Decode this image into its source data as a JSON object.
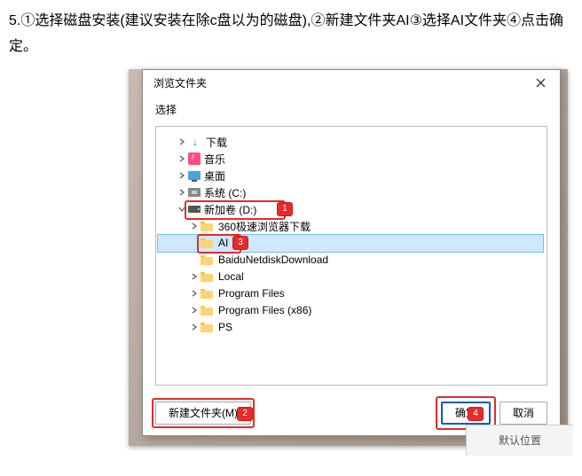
{
  "instruction": "5.①选择磁盘安装(建议安装在除c盘以为的磁盘),②新建文件夹AI③选择AI文件夹④点击确定。",
  "dialog": {
    "title": "浏览文件夹",
    "prompt": "选择",
    "close_label": "×"
  },
  "tree": {
    "items": [
      {
        "label": "下载",
        "icon": "download",
        "depth": 1,
        "expand": "closed"
      },
      {
        "label": "音乐",
        "icon": "music",
        "depth": 1,
        "expand": "closed"
      },
      {
        "label": "桌面",
        "icon": "desktop",
        "depth": 1,
        "expand": "closed"
      },
      {
        "label": "系统 (C:)",
        "icon": "sys",
        "depth": 1,
        "expand": "closed"
      },
      {
        "label": "新加卷 (D:)",
        "icon": "drive",
        "depth": 1,
        "expand": "open",
        "hl": 1
      },
      {
        "label": "360极速浏览器下载",
        "icon": "folder",
        "depth": 2,
        "expand": "closed"
      },
      {
        "label": "AI",
        "icon": "folder",
        "depth": 2,
        "expand": "none",
        "sel": true,
        "hl": 3
      },
      {
        "label": "BaiduNetdiskDownload",
        "icon": "folder",
        "depth": 2,
        "expand": "none"
      },
      {
        "label": "Local",
        "icon": "folder",
        "depth": 2,
        "expand": "closed"
      },
      {
        "label": "Program Files",
        "icon": "folder",
        "depth": 2,
        "expand": "closed"
      },
      {
        "label": "Program Files (x86)",
        "icon": "folder",
        "depth": 2,
        "expand": "closed"
      },
      {
        "label": "PS",
        "icon": "folder",
        "depth": 2,
        "expand": "closed"
      }
    ]
  },
  "footer": {
    "new_folder": "新建文件夹(M)",
    "ok": "确定",
    "cancel": "取消"
  },
  "partial_button": "默认位置",
  "markers": {
    "m1": "1",
    "m2": "2",
    "m3": "3",
    "m4": "4"
  }
}
